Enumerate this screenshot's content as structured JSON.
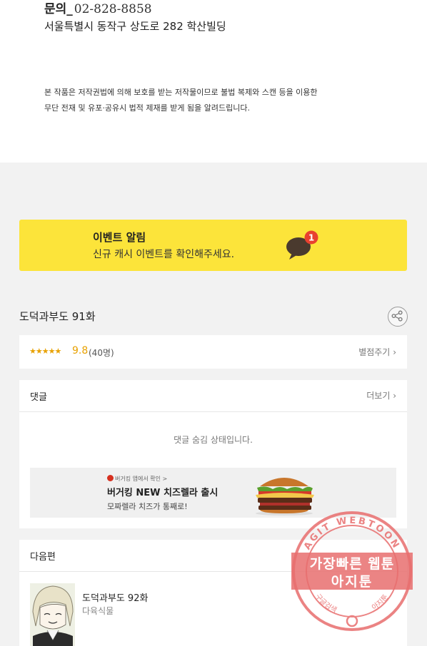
{
  "footer": {
    "contact_label": "문의_",
    "contact_number": "02-828-8858",
    "address": "서울특별시 동작구 상도로 282 학산빌딩",
    "copyright_line1": "본 작품은 저작권법에 의해 보호를 받는 저작물이므로 불법 복제와 스캔 등을 이용한",
    "copyright_line2": "무단 전재 및 유포·공유시 법적 제재를 받게 됨을 알려드립니다."
  },
  "event_banner": {
    "title": "이벤트 알림",
    "description": "신규 캐시 이벤트를 확인해주세요.",
    "badge_count": "1",
    "icon": "chat-bubble-icon",
    "background": "#fce43a"
  },
  "episode": {
    "title": "도덕과부도 91화",
    "share_icon": "share-icon"
  },
  "rating": {
    "stars": "★★★★★",
    "score": "9.8",
    "count": "(40명)",
    "rate_label": "별점주기",
    "accent": "#e8a100"
  },
  "comments": {
    "header": "댓글",
    "more_label": "더보기",
    "hidden_message": "댓글 숨김 상태입니다."
  },
  "ad": {
    "small_text": "버거킹 앱에서 확인 >",
    "title": "버거킹 NEW 치즈렐라 출시",
    "description": "모짜렐라 치즈가 통째로!"
  },
  "next_episode": {
    "header": "다음편",
    "title": "도덕과부도 92화",
    "author": "다육식물"
  },
  "watermark": {
    "ring_text": "AGIT WEBTOON",
    "line1": "가장빠른 웹툰",
    "line2": "아지툰",
    "bottom_left": "구글검색",
    "bottom_right": "아지툰",
    "color": "#e86e6e"
  },
  "chevron": "›"
}
